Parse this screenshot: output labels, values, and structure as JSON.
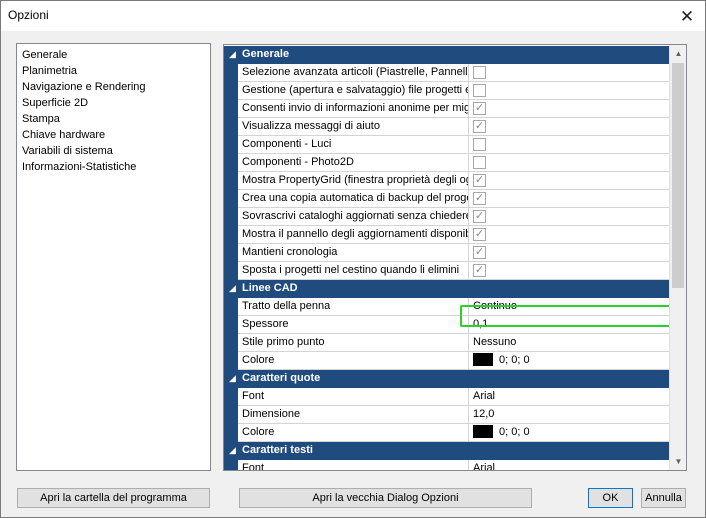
{
  "window": {
    "title": "Opzioni",
    "close_glyph": "✕"
  },
  "nav": {
    "items": [
      {
        "label": "Generale"
      },
      {
        "label": "Planimetria"
      },
      {
        "label": "Navigazione e Rendering"
      },
      {
        "label": "Superficie 2D"
      },
      {
        "label": "Stampa"
      },
      {
        "label": "Chiave hardware"
      },
      {
        "label": "Variabili di sistema"
      },
      {
        "label": "Informazioni-Statistiche"
      }
    ]
  },
  "grid": {
    "categories": {
      "generale": "Generale",
      "linee_cad": "Linee CAD",
      "caratteri_quote": "Caratteri quote",
      "caratteri_testi": "Caratteri testi"
    },
    "generale_rows": [
      {
        "name": "Selezione avanzata articoli (Piastrelle, Pannelli, Tessere)",
        "checked": false
      },
      {
        "name": "Gestione (apertura e salvataggio) file progetti e cataloghi",
        "checked": false
      },
      {
        "name": "Consenti invio di informazioni anonime per migliorare il prodotto",
        "checked": true
      },
      {
        "name": "Visualizza messaggi di aiuto",
        "checked": true
      },
      {
        "name": "Componenti - Luci",
        "checked": false
      },
      {
        "name": "Componenti - Photo2D",
        "checked": false
      },
      {
        "name": "Mostra PropertyGrid (finestra proprietà degli oggetti)",
        "checked": true
      },
      {
        "name": "Crea una copia automatica di backup del progetto",
        "checked": true
      },
      {
        "name": "Sovrascrivi cataloghi aggiornati senza chiedere conferma",
        "checked": true
      },
      {
        "name": "Mostra il pannello degli aggiornamenti disponibili",
        "checked": true
      },
      {
        "name": "Mantieni cronologia",
        "checked": true
      },
      {
        "name": "Sposta i progetti nel cestino quando li elimini",
        "checked": true
      }
    ],
    "linee_cad_rows": [
      {
        "name": "Tratto della penna",
        "value": "Continuo"
      },
      {
        "name": "Spessore",
        "value": "0,1"
      },
      {
        "name": "Stile primo punto",
        "value": "Nessuno"
      },
      {
        "name": "Colore",
        "value": "0; 0; 0",
        "swatch": "#000000"
      }
    ],
    "caratteri_quote_rows": [
      {
        "name": "Font",
        "value": "Arial"
      },
      {
        "name": "Dimensione",
        "value": "12,0"
      },
      {
        "name": "Colore",
        "value": "0; 0; 0",
        "swatch": "#000000"
      }
    ],
    "caratteri_testi_rows": [
      {
        "name": "Font",
        "value": "Arial"
      }
    ],
    "check_glyph": "✓",
    "scroll_up_glyph": "▲",
    "scroll_down_glyph": "▼",
    "collapse_glyph": "◢"
  },
  "buttons": {
    "open_folder": "Apri la cartella del programma",
    "old_dialog": "Apri la vecchia Dialog Opzioni",
    "ok": "OK",
    "cancel": "Annulla"
  },
  "colors": {
    "category_header": "#1f4b7f",
    "highlight": "#2bd12b"
  }
}
